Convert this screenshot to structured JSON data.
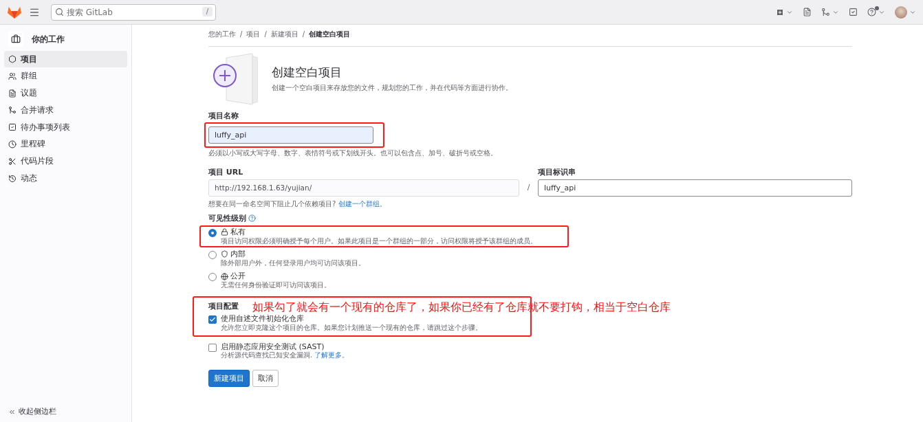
{
  "topbar": {
    "search": {
      "placeholder": "搜索 GitLab",
      "shortcut": "/"
    }
  },
  "sidebar": {
    "title": "你的工作",
    "items": [
      {
        "label": "项目",
        "selected": true
      },
      {
        "label": "群组",
        "selected": false
      },
      {
        "label": "议题",
        "selected": false
      },
      {
        "label": "合并请求",
        "selected": false
      },
      {
        "label": "待办事项列表",
        "selected": false
      },
      {
        "label": "里程碑",
        "selected": false
      },
      {
        "label": "代码片段",
        "selected": false
      },
      {
        "label": "动态",
        "selected": false
      }
    ],
    "collapse": "收起侧边栏"
  },
  "breadcrumbs": {
    "separator": "/",
    "items": [
      "您的工作",
      "项目",
      "新建项目",
      "创建空白项目"
    ]
  },
  "header": {
    "title": "创建空白项目",
    "description": "创建一个空白项目来存放您的文件，规划您的工作，并在代码等方面进行协作。"
  },
  "name_field": {
    "label": "项目名称",
    "value": "luffy_api",
    "hint": "必须以小写或大写字母、数字、表情符号或下划线开头。也可以包含点、加号、破折号或空格。",
    "highlighted": true
  },
  "url_field": {
    "label": "项目 URL",
    "value": "http://192.168.1.63/yujian/",
    "separator": "/",
    "help": "想要在同一命名空间下阻止几个依赖项目? ",
    "help_link": "创建一个群组。"
  },
  "slug_field": {
    "label": "项目标识串",
    "value": "luffy_api"
  },
  "visibility": {
    "label": "可见性级别",
    "options": [
      {
        "kind": "private",
        "label": "私有",
        "description": "项目访问权限必须明确授予每个用户。如果此项目是一个群组的一部分，访问权限将授予该群组的成员。",
        "selected": true,
        "highlighted": true
      },
      {
        "kind": "internal",
        "label": "内部",
        "description": "除外部用户外，任何登录用户均可访问该项目。",
        "selected": false,
        "highlighted": false
      },
      {
        "kind": "public",
        "label": "公开",
        "description": "无需任何身份验证即可访问该项目。",
        "selected": false,
        "highlighted": false
      }
    ]
  },
  "config": {
    "label": "项目配置",
    "highlighted": true,
    "annotation": "如果勾了就会有一个现有的仓库了，如果你已经有了仓库就不要打钩，相当于空白仓库",
    "options": [
      {
        "label": "使用自述文件初始化仓库",
        "description": "允许您立即克隆这个项目的仓库。如果您计划推送一个现有的仓库，请跳过这个步骤。",
        "checked": true
      },
      {
        "label": "启用静态应用安全测试 (SAST)",
        "description": "分析源代码查找已知安全漏洞. ",
        "link": "了解更多。",
        "checked": false
      }
    ]
  },
  "buttons": {
    "primary": "新建项目",
    "cancel": "取消"
  }
}
